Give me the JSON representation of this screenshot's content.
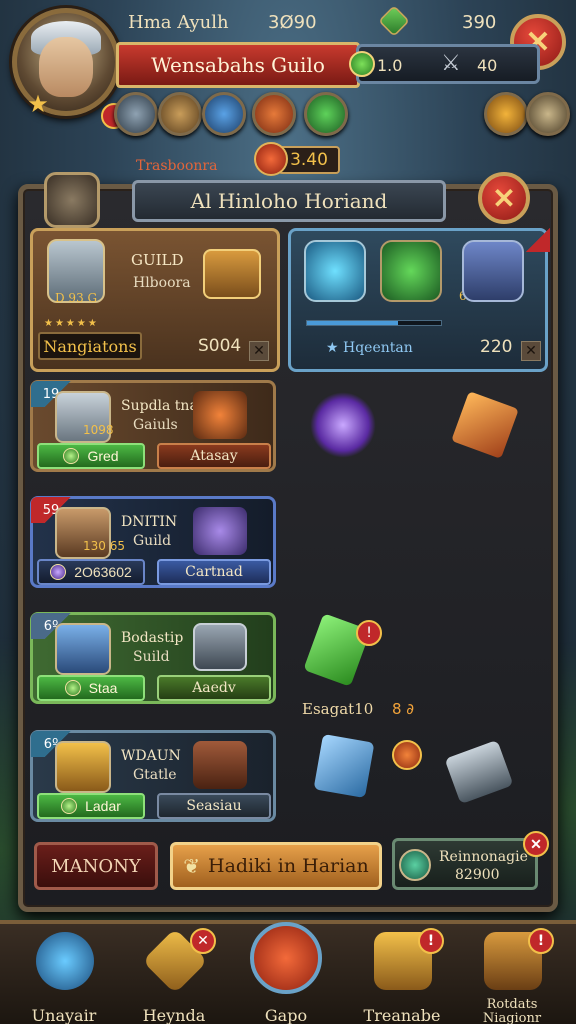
{
  "hud": {
    "player_name": "Hma Ayulh",
    "gold": "3Ø90",
    "gems": "390",
    "guild_banner": "Wensabahs Guilo",
    "resource_1": "1.0",
    "resource_2": "40",
    "sub_label": "Trasboonra",
    "sub_value": "3.40"
  },
  "panel": {
    "title": "Al Hinloho Horiand"
  },
  "featured_left": {
    "kicker": "GUILD",
    "sub": "Hlboora",
    "stats": "D 93 G",
    "name": "Nangiatons",
    "price": "S004"
  },
  "featured_right": {
    "stats": "6 -6",
    "label": "Hqeentan",
    "price": "220",
    "progress": 0.68
  },
  "guilds": [
    {
      "rank": "19",
      "title": "Supdla tna",
      "sub": "Gaiuls",
      "stat": "1098",
      "left_btn": "Gred",
      "right_btn": "Atasay"
    },
    {
      "rank": "59",
      "title": "DNITIN",
      "sub": "Guild",
      "stat": "130 65",
      "left_btn": "2O63602",
      "right_btn": "Cartnad"
    },
    {
      "rank": "6º",
      "title": "Bodastip",
      "sub": "Suild",
      "stat": "",
      "left_btn": "Staa",
      "right_btn": "Aaedv"
    },
    {
      "rank": "6º",
      "title": "WDAUN",
      "sub": "Gtatle",
      "stat": "",
      "left_btn": "Ladar",
      "right_btn": "Seasiau"
    }
  ],
  "loot": {
    "text": "Esagat10",
    "icons": "8 ∂"
  },
  "actions": {
    "manage": "MANONY",
    "main": "Hadiki in Harian",
    "side_title": "Reinnonagie",
    "side_value": "82900"
  },
  "nav": [
    {
      "label": "Unayair",
      "icon": "gem-icon"
    },
    {
      "label": "Heynda",
      "icon": "scroll-icon"
    },
    {
      "label": "Gapo",
      "icon": "emblem-icon"
    },
    {
      "label": "Treanabe",
      "icon": "chest-icon"
    },
    {
      "label": "Rotdats Niagionr",
      "icon": "crate-icon"
    }
  ]
}
